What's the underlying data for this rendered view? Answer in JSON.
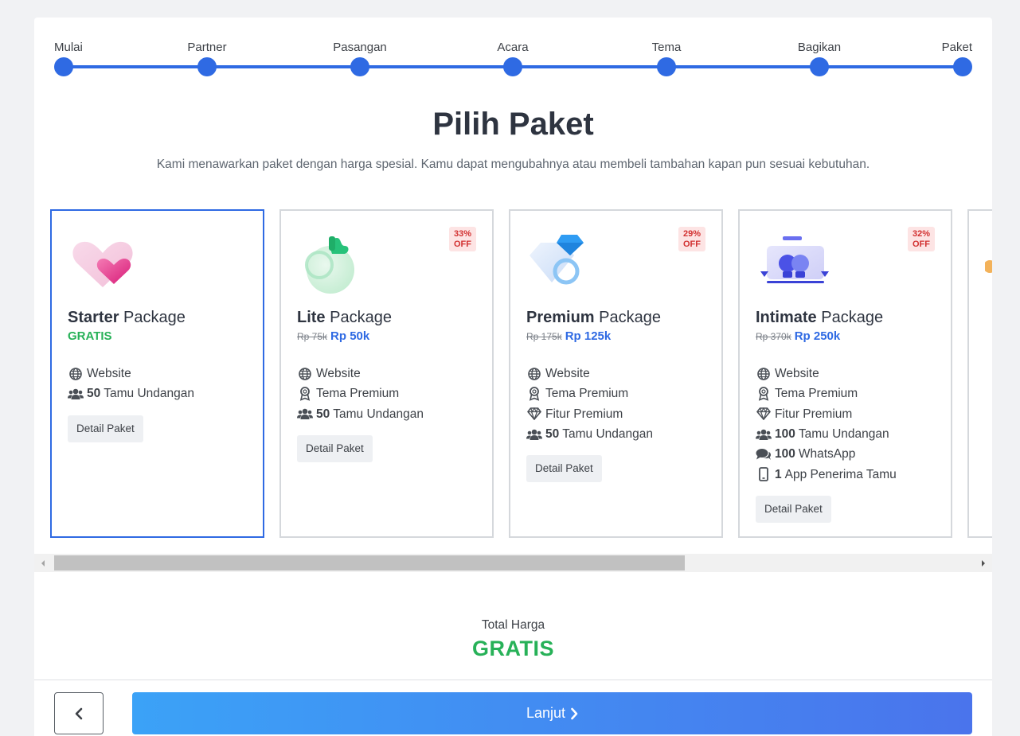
{
  "stepper": {
    "steps": [
      "Mulai",
      "Partner",
      "Pasangan",
      "Acara",
      "Tema",
      "Bagikan",
      "Paket"
    ]
  },
  "heading": "Pilih Paket",
  "subtitle": "Kami menawarkan paket dengan harga spesial. Kamu dapat mengubahnya atau membeli tambahan kapan pun sesuai kebutuhan.",
  "packages": [
    {
      "name_bold": "Starter",
      "name_rest": " Package",
      "price_old": "",
      "price": "GRATIS",
      "badge_pct": "",
      "badge_off": "",
      "features": [
        {
          "icon": "globe-icon",
          "bold": "",
          "text": "Website"
        },
        {
          "icon": "users-icon",
          "bold": "50",
          "text": "Tamu Undangan"
        }
      ],
      "detail_label": "Detail Paket"
    },
    {
      "name_bold": "Lite",
      "name_rest": " Package",
      "price_old": "Rp 75k",
      "price": "Rp 50k",
      "badge_pct": "33%",
      "badge_off": "OFF",
      "features": [
        {
          "icon": "globe-icon",
          "bold": "",
          "text": "Website"
        },
        {
          "icon": "award-icon",
          "bold": "",
          "text": "Tema Premium"
        },
        {
          "icon": "users-icon",
          "bold": "50",
          "text": "Tamu Undangan"
        }
      ],
      "detail_label": "Detail Paket"
    },
    {
      "name_bold": "Premium",
      "name_rest": " Package",
      "price_old": "Rp 175k",
      "price": "Rp 125k",
      "badge_pct": "29%",
      "badge_off": "OFF",
      "features": [
        {
          "icon": "globe-icon",
          "bold": "",
          "text": "Website"
        },
        {
          "icon": "award-icon",
          "bold": "",
          "text": "Tema Premium"
        },
        {
          "icon": "diamond-icon",
          "bold": "",
          "text": "Fitur Premium"
        },
        {
          "icon": "users-icon",
          "bold": "50",
          "text": "Tamu Undangan"
        }
      ],
      "detail_label": "Detail Paket"
    },
    {
      "name_bold": "Intimate",
      "name_rest": " Package",
      "price_old": "Rp 370k",
      "price": "Rp 250k",
      "badge_pct": "32%",
      "badge_off": "OFF",
      "features": [
        {
          "icon": "globe-icon",
          "bold": "",
          "text": "Website"
        },
        {
          "icon": "award-icon",
          "bold": "",
          "text": "Tema Premium"
        },
        {
          "icon": "diamond-icon",
          "bold": "",
          "text": "Fitur Premium"
        },
        {
          "icon": "users-icon",
          "bold": "100",
          "text": "Tamu Undangan"
        },
        {
          "icon": "comments-icon",
          "bold": "100",
          "text": "WhatsApp"
        },
        {
          "icon": "mobile-icon",
          "bold": "1",
          "text": "App Penerima Tamu"
        }
      ],
      "detail_label": "Detail Paket"
    }
  ],
  "total": {
    "label": "Total Harga",
    "value": "GRATIS"
  },
  "nav": {
    "next_label": "Lanjut"
  },
  "colors": {
    "accent": "#2f6ae3",
    "free": "#27b158",
    "badge_bg": "#fde4e4",
    "badge_text": "#d23131"
  }
}
